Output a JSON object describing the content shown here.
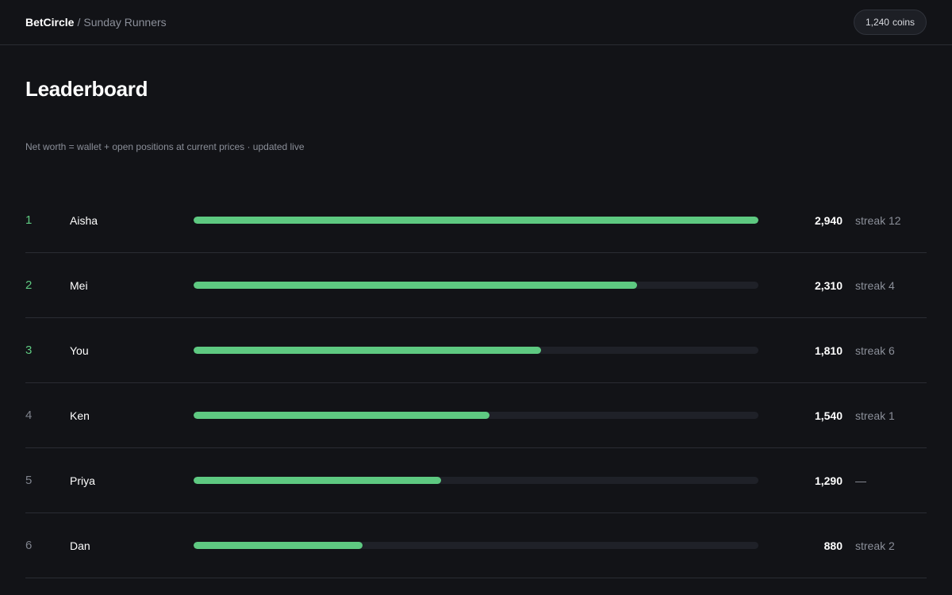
{
  "header": {
    "brand": "BetCircle",
    "separator": "/",
    "group": "Sunday Runners",
    "coins_value": "1,240",
    "coins_unit": "coins"
  },
  "page": {
    "title": "Leaderboard",
    "subtitle": "Net worth = wallet + open positions at current prices · updated live"
  },
  "colors": {
    "accent": "#5ec981",
    "background": "#121317",
    "track": "#1f2128"
  },
  "leaderboard": [
    {
      "rank": "1",
      "name": "Aisha",
      "net_worth": "2,940",
      "value": 2940,
      "streak": "streak 12",
      "highlight": true
    },
    {
      "rank": "2",
      "name": "Mei",
      "net_worth": "2,310",
      "value": 2310,
      "streak": "streak 4",
      "highlight": true
    },
    {
      "rank": "3",
      "name": "You",
      "net_worth": "1,810",
      "value": 1810,
      "streak": "streak 6",
      "highlight": true
    },
    {
      "rank": "4",
      "name": "Ken",
      "net_worth": "1,540",
      "value": 1540,
      "streak": "streak 1",
      "highlight": false
    },
    {
      "rank": "5",
      "name": "Priya",
      "net_worth": "1,290",
      "value": 1290,
      "streak": "—",
      "highlight": false
    },
    {
      "rank": "6",
      "name": "Dan",
      "net_worth": "880",
      "value": 880,
      "streak": "streak 2",
      "highlight": false
    }
  ]
}
